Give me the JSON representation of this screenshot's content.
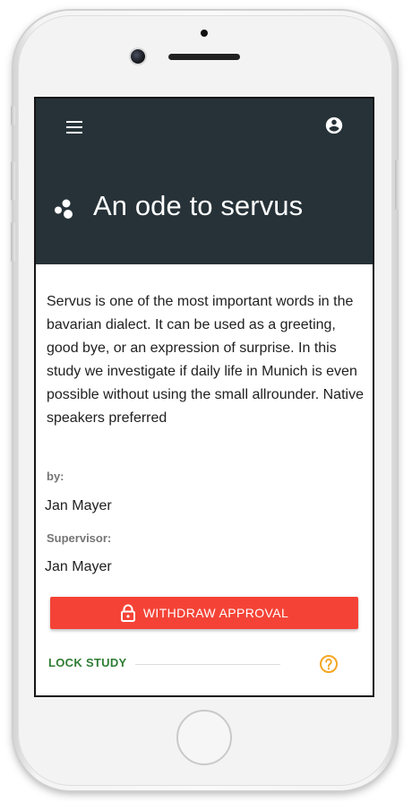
{
  "app": {
    "title": "An ode to servus",
    "header_color": "#263238"
  },
  "study": {
    "description": "Servus is one of the most important words in the bavarian dialect. It can be used as a greeting, good bye, or an expression of surprise. In this study we investigate if daily life in Munich is even possible without using the small allrounder. Native speakers preferred",
    "author_label": "by:",
    "author": "Jan Mayer",
    "supervisor_label": "Supervisor:",
    "supervisor": "Jan Mayer"
  },
  "actions": {
    "withdraw_label": "WITHDRAW APPROVAL",
    "withdraw_color": "#f44336",
    "lock_label": "LOCK STUDY",
    "lock_color": "#2e7d32",
    "help_color": "#f5a623"
  },
  "icons": {
    "menu": "menu-icon",
    "account": "account-circle-icon",
    "logo": "bubbles-logo-icon",
    "lock": "lock-icon",
    "help": "help-circle-icon"
  }
}
